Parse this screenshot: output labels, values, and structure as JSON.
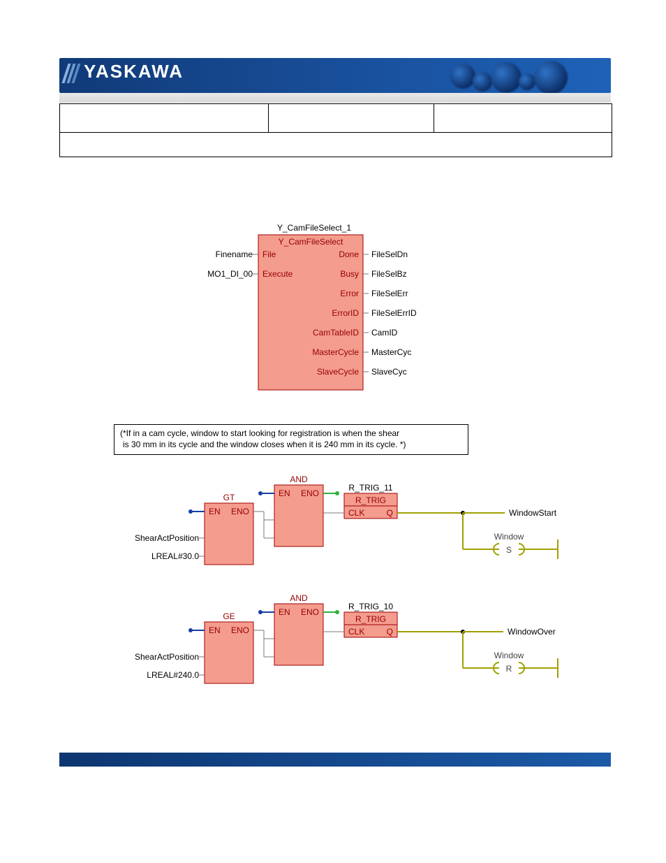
{
  "brand": "YASKAWA",
  "comment": {
    "line1": "(*If in a cam cycle, window to start looking for registration is when the shear",
    "line2": "is 30 mm in its cycle and the window closes when it is 240 mm in its cycle. *)"
  },
  "block1": {
    "instance": "Y_CamFileSelect_1",
    "type": "Y_CamFileSelect",
    "left": [
      {
        "port": "File",
        "var": "Finename"
      },
      {
        "port": "Execute",
        "var": "MO1_DI_00"
      }
    ],
    "right": [
      {
        "port": "Done",
        "var": "FileSelDn"
      },
      {
        "port": "Busy",
        "var": "FileSelBz"
      },
      {
        "port": "Error",
        "var": "FileSelErr"
      },
      {
        "port": "ErrorID",
        "var": "FileSelErrID"
      },
      {
        "port": "CamTableID",
        "var": "CamID"
      },
      {
        "port": "MasterCycle",
        "var": "MasterCyc"
      },
      {
        "port": "SlaveCycle",
        "var": "SlaveCyc"
      }
    ]
  },
  "rung1": {
    "gt": {
      "type": "GT",
      "en": "EN",
      "eno": "ENO",
      "in1": "ShearActPosition",
      "in2": "LREAL#30.0"
    },
    "and": {
      "type": "AND",
      "en": "EN",
      "eno": "ENO"
    },
    "rtrig": {
      "instance": "R_TRIG_11",
      "type": "R_TRIG",
      "clk": "CLK",
      "q": "Q"
    },
    "out1": "WindowStart",
    "coil": {
      "label": "Window",
      "type": "S"
    }
  },
  "rung2": {
    "ge": {
      "type": "GE",
      "en": "EN",
      "eno": "ENO",
      "in1": "ShearActPosition",
      "in2": "LREAL#240.0"
    },
    "and": {
      "type": "AND",
      "en": "EN",
      "eno": "ENO"
    },
    "rtrig": {
      "instance": "R_TRIG_10",
      "type": "R_TRIG",
      "clk": "CLK",
      "q": "Q"
    },
    "out1": "WindowOver",
    "coil": {
      "label": "Window",
      "type": "R"
    }
  },
  "chart_data": {
    "type": "table",
    "title": "Function block diagram — Y_CamFileSelect and registration-window rungs",
    "blocks": [
      {
        "instance": "Y_CamFileSelect_1",
        "type": "Y_CamFileSelect",
        "inputs": {
          "File": "Finename",
          "Execute": "MO1_DI_00"
        },
        "outputs": {
          "Done": "FileSelDn",
          "Busy": "FileSelBz",
          "Error": "FileSelErr",
          "ErrorID": "FileSelErrID",
          "CamTableID": "CamID",
          "MasterCycle": "MasterCyc",
          "SlaveCycle": "SlaveCyc"
        }
      }
    ],
    "rungs": [
      {
        "condition": "ShearActPosition > 30.0",
        "logic": [
          "GT",
          "AND",
          "R_TRIG_11"
        ],
        "outputs": [
          "WindowStart",
          {
            "coil": "Window",
            "action": "S"
          }
        ],
        "window_start_mm": 30
      },
      {
        "condition": "ShearActPosition >= 240.0",
        "logic": [
          "GE",
          "AND",
          "R_TRIG_10"
        ],
        "outputs": [
          "WindowOver",
          {
            "coil": "Window",
            "action": "R"
          }
        ],
        "window_end_mm": 240
      }
    ],
    "comment": "If in a cam cycle, window to start looking for registration is when the shear is 30 mm in its cycle and the window closes when it is 240 mm in its cycle."
  }
}
